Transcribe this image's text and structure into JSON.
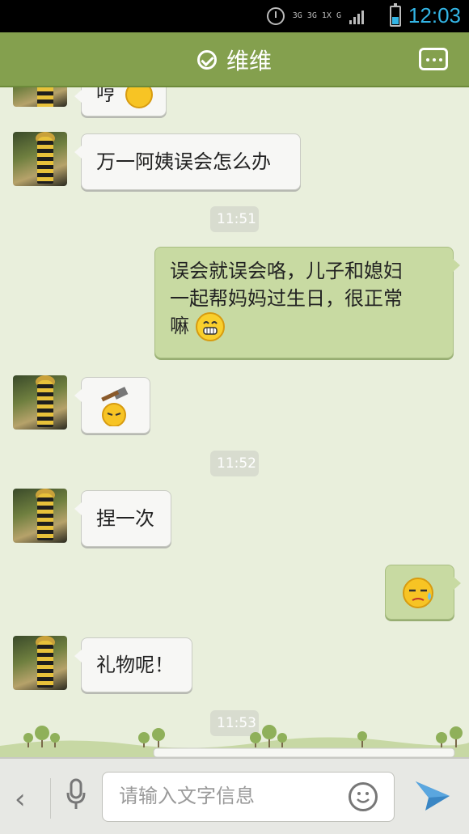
{
  "status_bar": {
    "time": "12:03",
    "network_label": "3G 3G 1X G",
    "icons": [
      "alarm-icon",
      "network-icon",
      "signal-icon",
      "battery-icon"
    ],
    "accent": "#33b5e5"
  },
  "header": {
    "title": "维维",
    "verified_icon": "check-circle-icon",
    "menu_icon": "more-options-icon",
    "color": "#84a04e"
  },
  "messages": [
    {
      "side": "in",
      "text": "哼"
    },
    {
      "side": "in",
      "text": "万一阿姨误会怎么办"
    },
    {
      "type": "time",
      "text": "11:51"
    },
    {
      "side": "out",
      "lines": [
        "误会就误会咯，儿子和媳妇",
        "一起帮妈妈过生日，很正常",
        "嘛"
      ]
    },
    {
      "side": "in",
      "sticker": "hammer-smack-emoji"
    },
    {
      "type": "time",
      "text": "11:52"
    },
    {
      "side": "in",
      "text": "捏一次"
    },
    {
      "side": "out",
      "sticker": "sweat-emoji"
    },
    {
      "side": "in",
      "text": "礼物呢！"
    },
    {
      "type": "time",
      "text": "11:53"
    }
  ],
  "input_bar": {
    "placeholder": "请输入文字信息",
    "value": "",
    "icons": [
      "back-chevron-icon",
      "microphone-icon",
      "smiley-icon",
      "send-icon"
    ]
  }
}
